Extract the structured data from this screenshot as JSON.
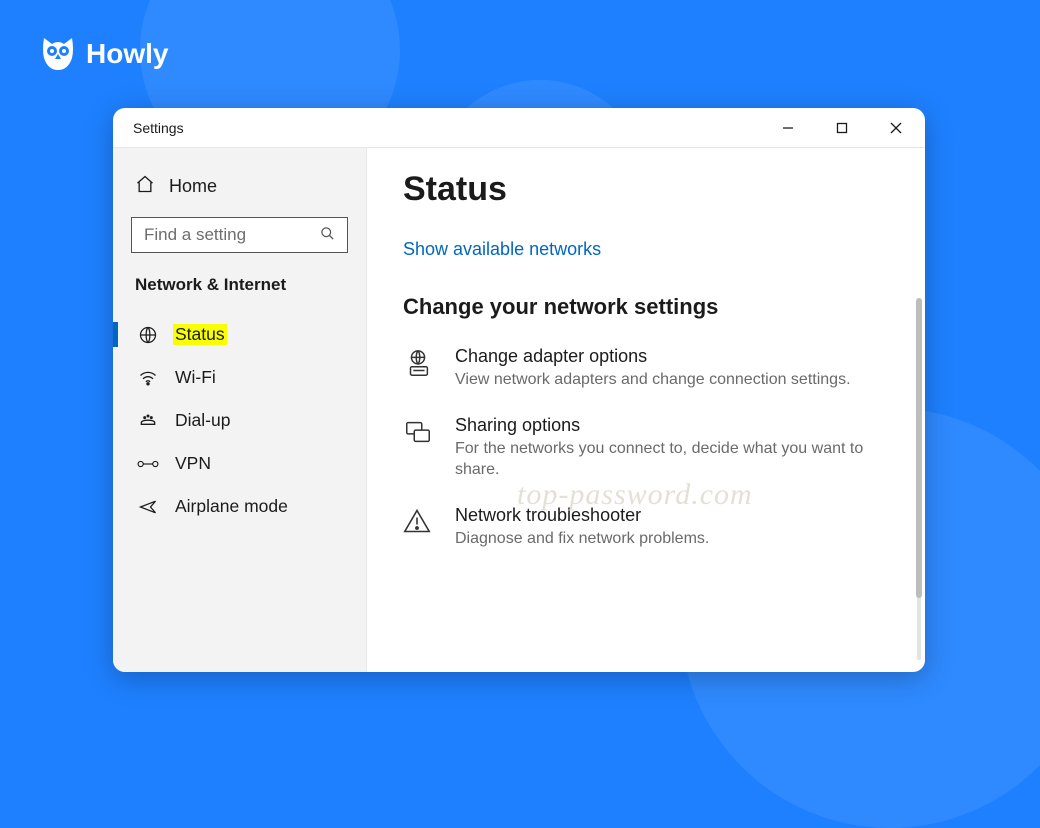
{
  "brand": {
    "name": "Howly"
  },
  "window": {
    "title": "Settings"
  },
  "sidebar": {
    "home": "Home",
    "search_placeholder": "Find a setting",
    "section": "Network & Internet",
    "items": [
      {
        "label": "Status",
        "icon": "globe-icon",
        "active": true
      },
      {
        "label": "Wi-Fi",
        "icon": "wifi-icon",
        "active": false
      },
      {
        "label": "Dial-up",
        "icon": "dialup-icon",
        "active": false
      },
      {
        "label": "VPN",
        "icon": "vpn-icon",
        "active": false
      },
      {
        "label": "Airplane mode",
        "icon": "airplane-icon",
        "active": false
      }
    ]
  },
  "main": {
    "heading": "Status",
    "show_networks_link": "Show available networks",
    "change_heading": "Change your network settings",
    "watermark": "top-password.com",
    "options": [
      {
        "title": "Change adapter options",
        "desc": "View network adapters and change connection settings.",
        "icon": "adapter-icon",
        "highlighted": true
      },
      {
        "title": "Sharing options",
        "desc": "For the networks you connect to, decide what you want to share.",
        "icon": "sharing-icon",
        "highlighted": false
      },
      {
        "title": "Network troubleshooter",
        "desc": "Diagnose and fix network problems.",
        "icon": "warning-icon",
        "highlighted": false
      }
    ]
  }
}
